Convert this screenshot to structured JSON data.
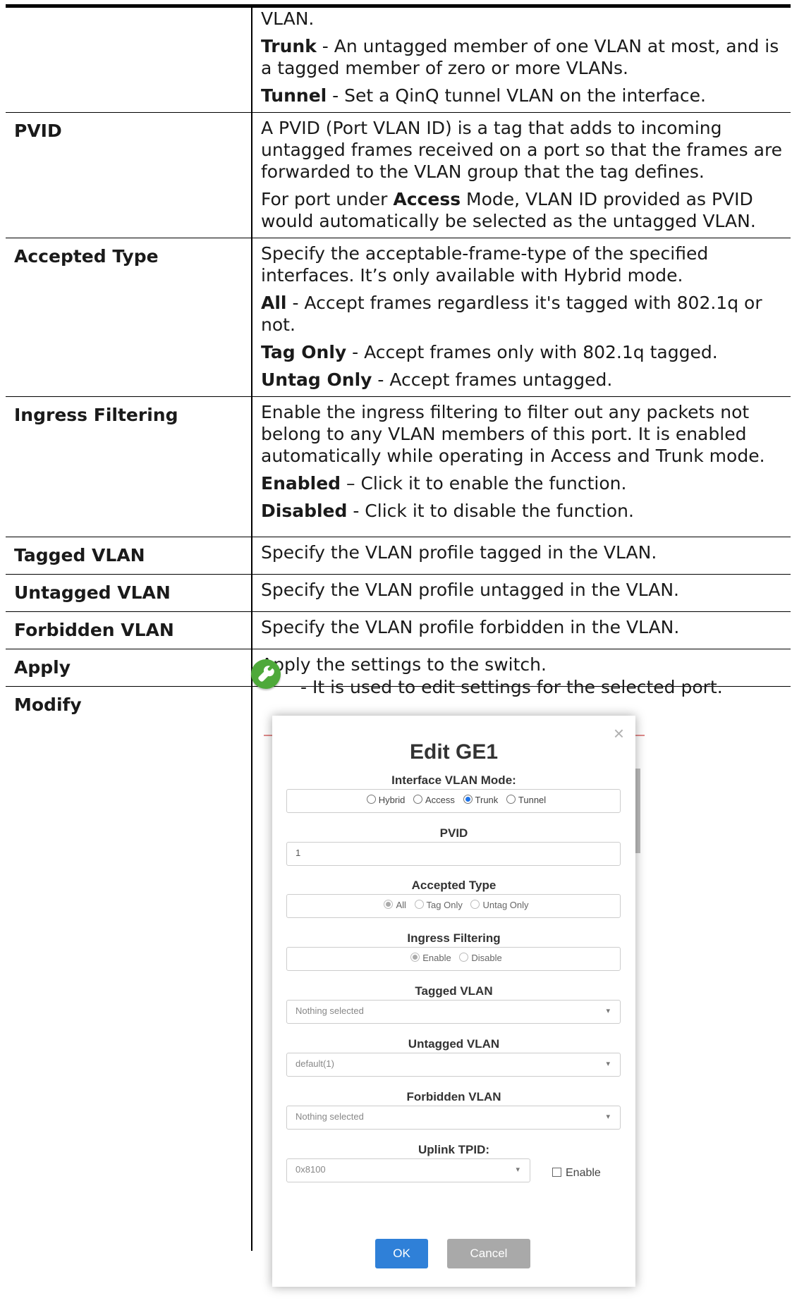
{
  "rows": [
    {
      "key": "",
      "paras": [
        {
          "text": "VLAN."
        },
        {
          "bold": "Trunk",
          "rest": " - An untagged member of one VLAN at most, and is a tagged member of zero or more VLANs."
        },
        {
          "bold": "Tunnel",
          "rest": " - Set a QinQ tunnel VLAN on the interface."
        }
      ]
    },
    {
      "key": "PVID",
      "paras": [
        {
          "text": "A PVID (Port VLAN ID) is a tag that adds to incoming untagged frames received on a port so that the frames are forwarded to the VLAN group that the tag defines."
        },
        {
          "pre": "For port under ",
          "bold": "Access",
          "rest": " Mode, VLAN ID provided as PVID would automatically be selected as the untagged VLAN."
        }
      ]
    },
    {
      "key": "Accepted Type",
      "paras": [
        {
          "text": "Specify the acceptable-frame-type of the specified interfaces. It’s only available with Hybrid mode."
        },
        {
          "bold": "All",
          "rest": " - Accept frames regardless it's tagged with 802.1q or not."
        },
        {
          "bold": "Tag Only",
          "rest": " - Accept frames only with 802.1q tagged."
        },
        {
          "bold": "Untag Only",
          "rest": " - Accept frames untagged."
        }
      ]
    },
    {
      "key": "Ingress Filtering",
      "paras": [
        {
          "text": "Enable the ingress filtering to filter out any packets not belong to any VLAN members of this port. It is enabled automatically while operating in Access and Trunk mode."
        },
        {
          "bold": "Enabled",
          "rest": " – Click it to enable the function."
        },
        {
          "bold": "Disabled",
          "rest": " - Click it to disable the function."
        }
      ]
    },
    {
      "key": "Tagged VLAN",
      "paras": [
        {
          "text": "Specify the VLAN profile tagged in the VLAN."
        }
      ]
    },
    {
      "key": "Untagged VLAN",
      "paras": [
        {
          "text": "Specify the VLAN profile untagged in the VLAN."
        }
      ]
    },
    {
      "key": "Forbidden VLAN",
      "paras": [
        {
          "text": "Specify the VLAN profile forbidden in the VLAN."
        }
      ]
    },
    {
      "key": "Apply",
      "paras": [
        {
          "text": "Apply the settings to the switch."
        }
      ]
    }
  ],
  "modify": {
    "key": "Modify",
    "icon": "wrench-icon",
    "description": "- It is used to edit settings for the selected port."
  },
  "dialog": {
    "title": "Edit GE1",
    "close": "×",
    "mode_label": "Interface VLAN Mode:",
    "modes": [
      "Hybrid",
      "Access",
      "Trunk",
      "Tunnel"
    ],
    "mode_selected": "Trunk",
    "pvid_label": "PVID",
    "pvid_value": "1",
    "accepted_label": "Accepted Type",
    "accepted_options": [
      "All",
      "Tag Only",
      "Untag Only"
    ],
    "accepted_selected": "All",
    "ingress_label": "Ingress Filtering",
    "ingress_options": [
      "Enable",
      "Disable"
    ],
    "ingress_selected": "Enable",
    "tagged_label": "Tagged VLAN",
    "tagged_value": "Nothing selected",
    "untagged_label": "Untagged VLAN",
    "untagged_value": "default(1)",
    "forbidden_label": "Forbidden VLAN",
    "forbidden_value": "Nothing selected",
    "tpid_label": "Uplink TPID:",
    "tpid_value": "0x8100",
    "tpid_enable_label": "Enable",
    "ok_label": "OK",
    "cancel_label": "Cancel",
    "accent_color": "#2f80d8"
  }
}
